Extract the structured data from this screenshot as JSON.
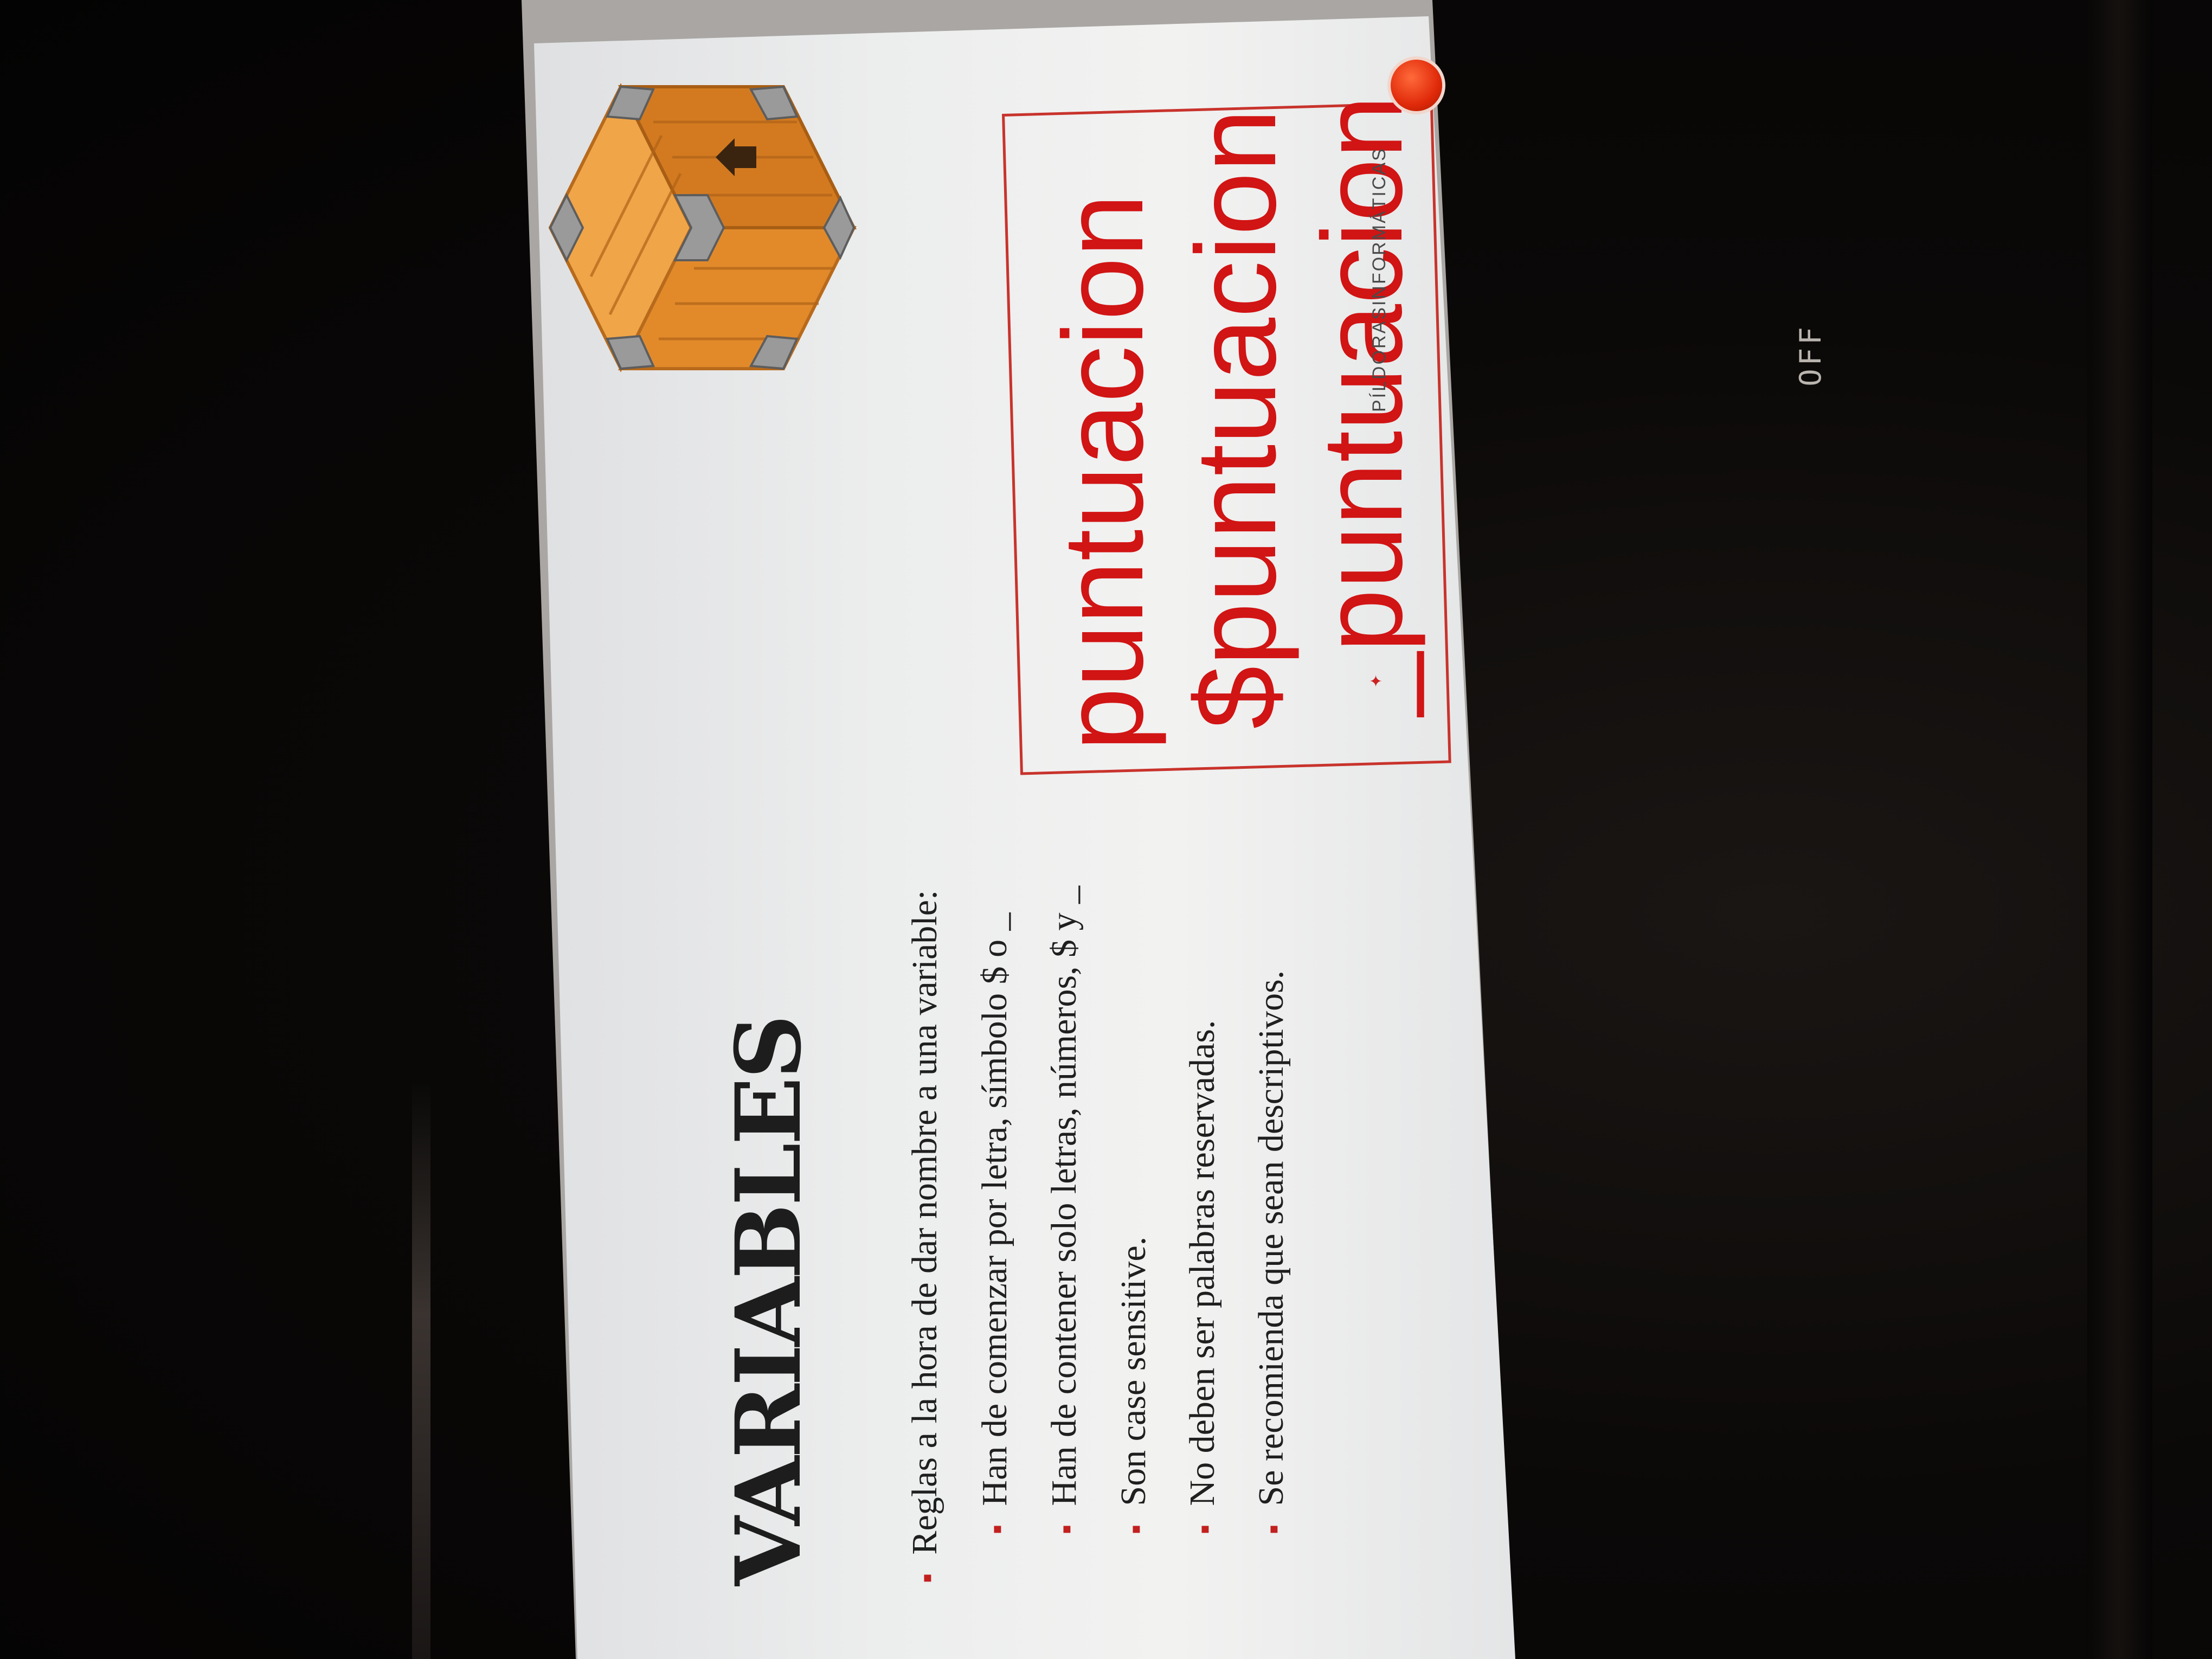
{
  "device": {
    "indicator_label": "OFF"
  },
  "slide": {
    "title": "VARIABLES",
    "bullets": [
      "Reglas a la hora de dar nombre a una variable:",
      "Han de comenzar por letra, símbolo $ o _",
      "Han de contener solo letras, números, $ y _",
      "Son case sensitive.",
      "No deben ser palabras reservadas.",
      "Se recomienda que sean descriptivos."
    ],
    "bullet_marker": "▪",
    "examples": [
      "puntuacion",
      "$puntuacion",
      "_puntuacion"
    ],
    "watermark": "PÍLDORASINFORMÁTICAS",
    "colors": {
      "accent_red": "#d11414",
      "box_border": "#c8332c",
      "crate": "#e8902e"
    },
    "illustration": "wooden-crate-icon"
  }
}
